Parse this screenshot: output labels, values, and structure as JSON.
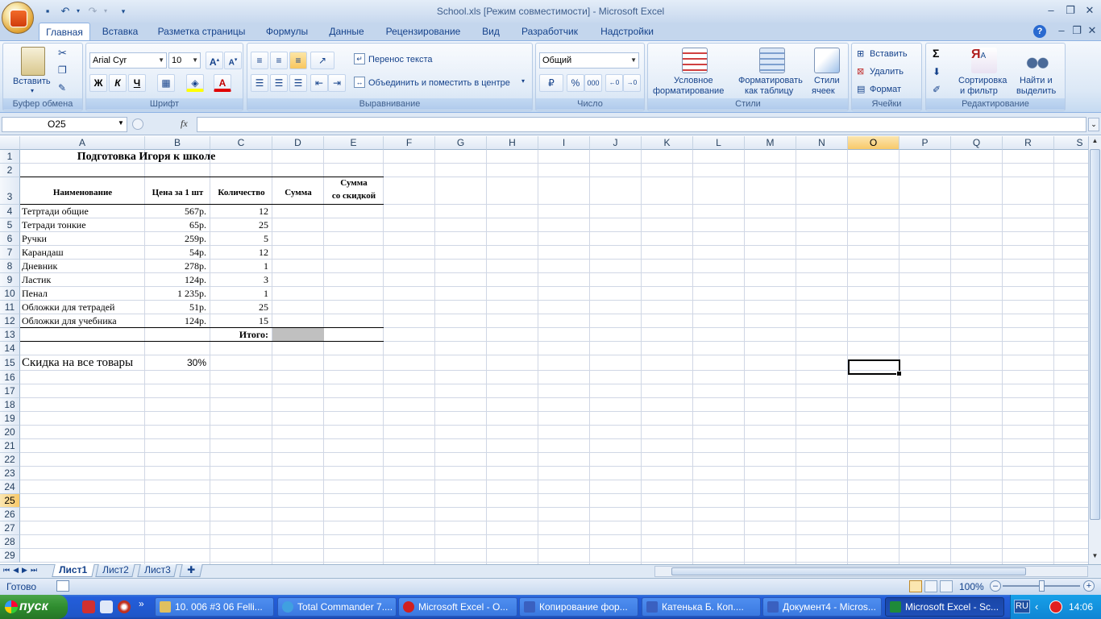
{
  "window": {
    "title": "School.xls  [Режим совместимости] - Microsoft Excel"
  },
  "ribbon_tabs": [
    "Главная",
    "Вставка",
    "Разметка страницы",
    "Формулы",
    "Данные",
    "Рецензирование",
    "Вид",
    "Разработчик",
    "Надстройки"
  ],
  "ribbon": {
    "clipboard": {
      "paste": "Вставить",
      "label": "Буфер обмена"
    },
    "font": {
      "name": "Arial Cyr",
      "size": "10",
      "bold": "Ж",
      "italic": "К",
      "underline": "Ч",
      "label": "Шрифт"
    },
    "alignment": {
      "wrap": "Перенос текста",
      "merge": "Объединить и поместить в центре",
      "label": "Выравнивание"
    },
    "number": {
      "format": "Общий",
      "label": "Число"
    },
    "styles": {
      "conditional_1": "Условное",
      "conditional_2": "форматирование",
      "table_1": "Форматировать",
      "table_2": "как таблицу",
      "cell_1": "Стили",
      "cell_2": "ячеек",
      "label": "Стили"
    },
    "cells": {
      "insert": "Вставить",
      "delete": "Удалить",
      "format": "Формат",
      "label": "Ячейки"
    },
    "editing": {
      "sort_1": "Сортировка",
      "sort_2": "и фильтр",
      "find_1": "Найти и",
      "find_2": "выделить",
      "label": "Редактирование"
    }
  },
  "formula_bar": {
    "name_box": "O25",
    "fx": "fx",
    "formula": ""
  },
  "columns": [
    "A",
    "B",
    "C",
    "D",
    "E",
    "F",
    "G",
    "H",
    "I",
    "J",
    "K",
    "L",
    "M",
    "N",
    "O",
    "P",
    "Q",
    "R",
    "S"
  ],
  "rows": [
    "1",
    "2",
    "3",
    "4",
    "5",
    "6",
    "7",
    "8",
    "9",
    "10",
    "11",
    "12",
    "13",
    "14",
    "15",
    "16",
    "17",
    "18",
    "19",
    "20",
    "21",
    "22",
    "23",
    "24",
    "25",
    "26",
    "27",
    "28",
    "29"
  ],
  "sheet": {
    "title": "Подготовка Игоря к школе",
    "headers": {
      "name": "Наименование",
      "price": "Цена за 1 шт",
      "qty": "Количество",
      "sum": "Сумма",
      "disc_1": "Сумма",
      "disc_2": "со скидкой"
    },
    "items": [
      {
        "name": "Тетртади общие",
        "price": "567р.",
        "qty": "12"
      },
      {
        "name": "Тетради тонкие",
        "price": "65р.",
        "qty": "25"
      },
      {
        "name": "Ручки",
        "price": "259р.",
        "qty": "5"
      },
      {
        "name": "Карандаш",
        "price": "54р.",
        "qty": "12"
      },
      {
        "name": "Дневник",
        "price": "278р.",
        "qty": "1"
      },
      {
        "name": "Ластик",
        "price": "124р.",
        "qty": "3"
      },
      {
        "name": "Пенал",
        "price": "1 235р.",
        "qty": "1"
      },
      {
        "name": "Обложки для тетрадей",
        "price": "51р.",
        "qty": "25"
      },
      {
        "name": "Обложки для учебника",
        "price": "124р.",
        "qty": "15"
      }
    ],
    "total_label": "Итого:",
    "discount_label": "Скидка на все товары",
    "discount_value": "30%"
  },
  "sheet_tabs": [
    "Лист1",
    "Лист2",
    "Лист3"
  ],
  "status": {
    "ready": "Готово",
    "zoom": "100%"
  },
  "taskbar": {
    "start": "пуск",
    "tasks": [
      "10. 006 #3 06 Felli...",
      "Total Commander 7....",
      "Microsoft Excel - О...",
      "Копирование фор...",
      "Катенька Б. Коп....",
      "Документ4 - Micros...",
      "Microsoft Excel - Sc..."
    ],
    "lang": "RU",
    "clock": "14:06"
  },
  "colors": {
    "accent": "#15428b",
    "selected_header": "#f8c96a",
    "total_fill": "#c0c0c0"
  }
}
